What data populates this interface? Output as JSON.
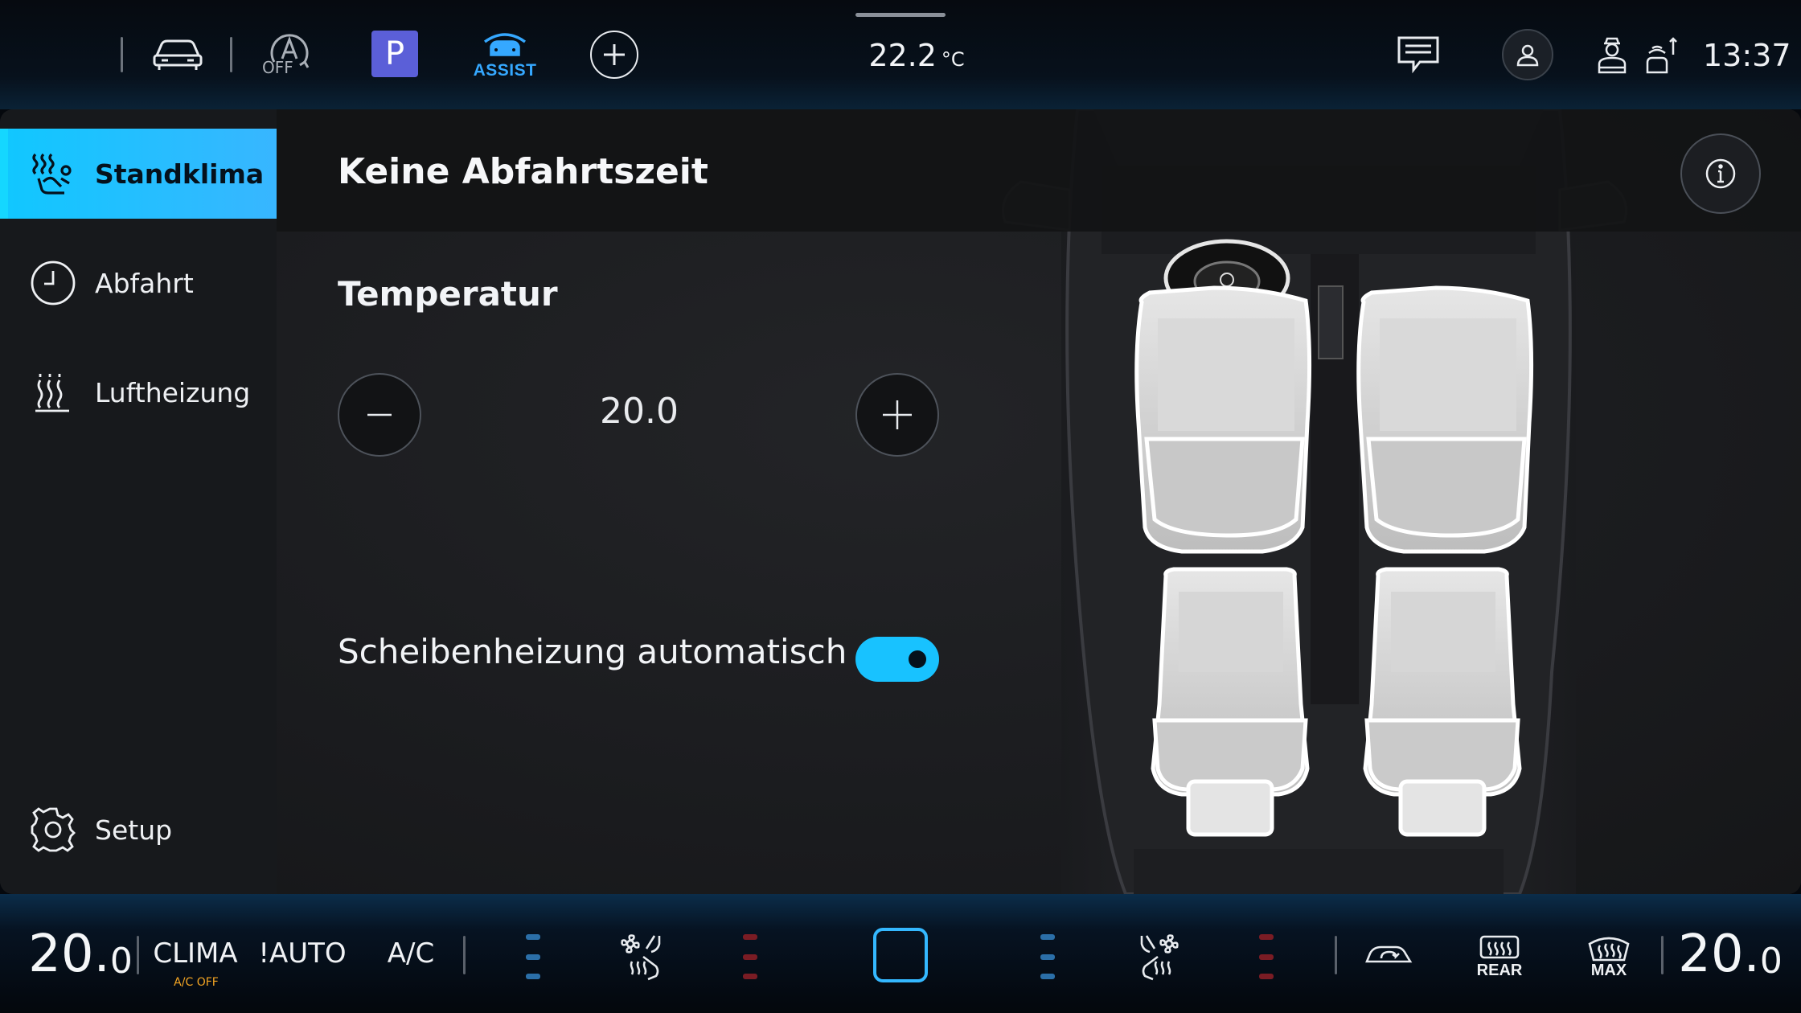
{
  "top_bar": {
    "auto_hold_label": "OFF",
    "park_label": "P",
    "assist_label": "ASSIST",
    "outside_temp": "22.2",
    "outside_temp_unit": "°C",
    "clock": "13:37"
  },
  "sidebar": {
    "items": [
      {
        "label": "Standklima",
        "icon": "seat-climate-icon",
        "active": true
      },
      {
        "label": "Abfahrt",
        "icon": "clock-icon",
        "active": false
      },
      {
        "label": "Luftheizung",
        "icon": "air-heating-icon",
        "active": false
      }
    ],
    "setup_label": "Setup"
  },
  "content": {
    "departure_title": "Keine Abfahrtszeit",
    "temperature_label": "Temperatur",
    "temperature_value": "20.0",
    "screen_heating_label": "Scheibenheizung automatisch",
    "screen_heating_enabled": true
  },
  "bottom_bar": {
    "left_temp_main": "20.",
    "left_temp_decimal": "0",
    "clima_label": "CLIMA",
    "ac_off_label": "A/C OFF",
    "auto_label": "!AUTO",
    "ac_label": "A/C",
    "rear_label": "REAR",
    "max_label": "MAX",
    "right_temp_main": "20.",
    "right_temp_decimal": "0"
  },
  "colors": {
    "accent": "#18c2ff",
    "active_tab": "#38b6ff",
    "park_badge": "#5b5fd8",
    "ac_off": "#f5a623",
    "seat_heat_blue": "#2b6fa8",
    "seat_heat_red": "#7a1c24"
  }
}
